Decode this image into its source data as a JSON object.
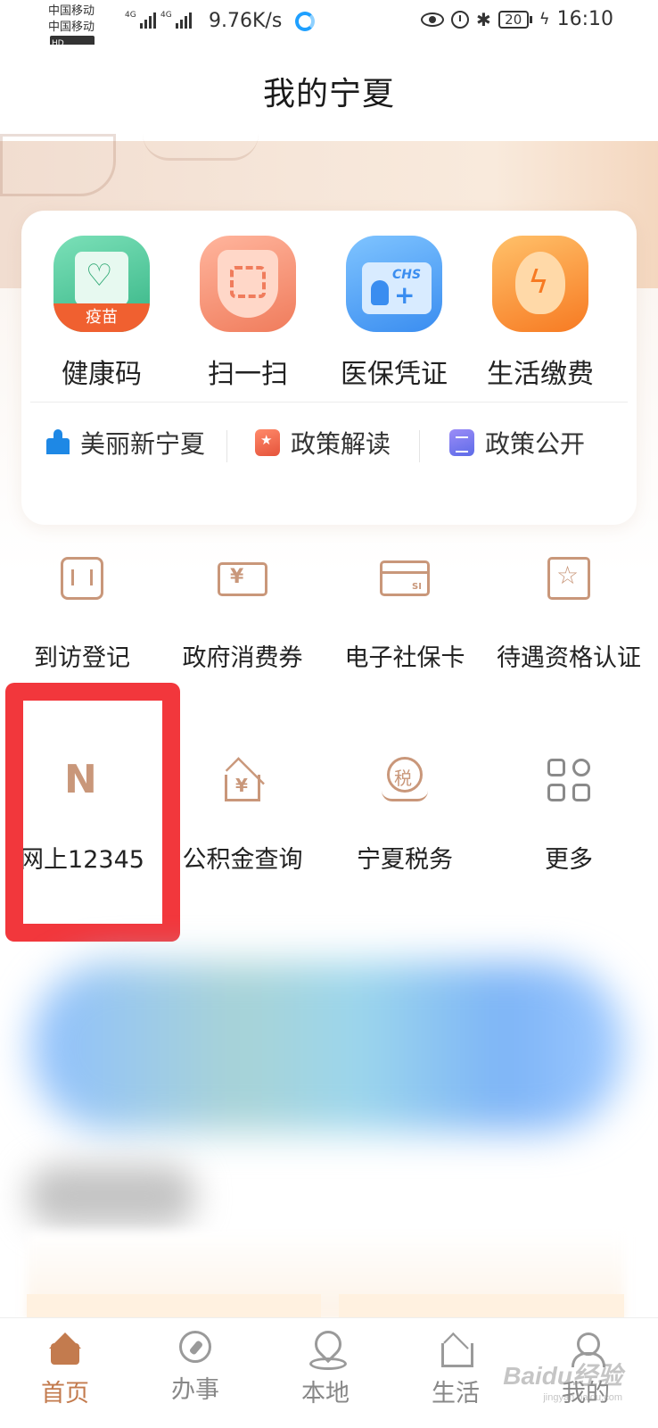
{
  "status_bar": {
    "carrier_1": "中国移动",
    "carrier_2": "中国移动",
    "hd_badge": "HD",
    "network_1": "4G",
    "network_2": "4G",
    "net_speed": "9.76K/s",
    "battery": "20",
    "time": "16:10",
    "icons": [
      "eye-icon",
      "alarm-icon",
      "bluetooth-icon",
      "battery-icon",
      "charging-icon",
      "qq-browser-icon"
    ]
  },
  "header": {
    "title": "我的宁夏"
  },
  "quick_actions": [
    {
      "label": "健康码",
      "badge": "疫苗",
      "icon": "health-code-icon"
    },
    {
      "label": "扫一扫",
      "icon": "scan-icon"
    },
    {
      "label": "医保凭证",
      "badge": "CHS",
      "icon": "medical-insurance-icon"
    },
    {
      "label": "生活缴费",
      "icon": "utility-payment-icon"
    }
  ],
  "quick_links": [
    {
      "label": "美丽新宁夏",
      "icon": "pavilion-icon"
    },
    {
      "label": "政策解读",
      "icon": "policy-interpretation-icon"
    },
    {
      "label": "政策公开",
      "icon": "policy-disclosure-icon"
    }
  ],
  "services": [
    {
      "label": "到访登记",
      "icon": "visit-register-icon"
    },
    {
      "label": "政府消费券",
      "icon": "coupon-icon",
      "glyph": "¥"
    },
    {
      "label": "电子社保卡",
      "icon": "social-security-card-icon",
      "glyph": "SI"
    },
    {
      "label": "待遇资格认证",
      "icon": "qualification-icon"
    },
    {
      "label": "网上12345",
      "icon": "hotline-12345-icon"
    },
    {
      "label": "公积金查询",
      "icon": "housing-fund-icon",
      "glyph": "¥"
    },
    {
      "label": "宁夏税务",
      "icon": "tax-icon",
      "glyph": "税"
    },
    {
      "label": "更多",
      "icon": "more-grid-icon"
    }
  ],
  "tab_bar": [
    {
      "label": "首页",
      "icon": "home-icon",
      "active": true
    },
    {
      "label": "办事",
      "icon": "compass-icon",
      "active": false
    },
    {
      "label": "本地",
      "icon": "location-pin-icon",
      "active": false
    },
    {
      "label": "生活",
      "icon": "life-house-icon",
      "active": false
    },
    {
      "label": "我的",
      "icon": "person-icon",
      "active": false
    }
  ],
  "watermark": {
    "text": "Baidu经验",
    "sub": "jingyan.baidu.com"
  },
  "colors": {
    "accent": "#c37b4e",
    "service_icon": "#c9977a",
    "highlight": "#f2373c",
    "banner": "#f6e6d9"
  }
}
